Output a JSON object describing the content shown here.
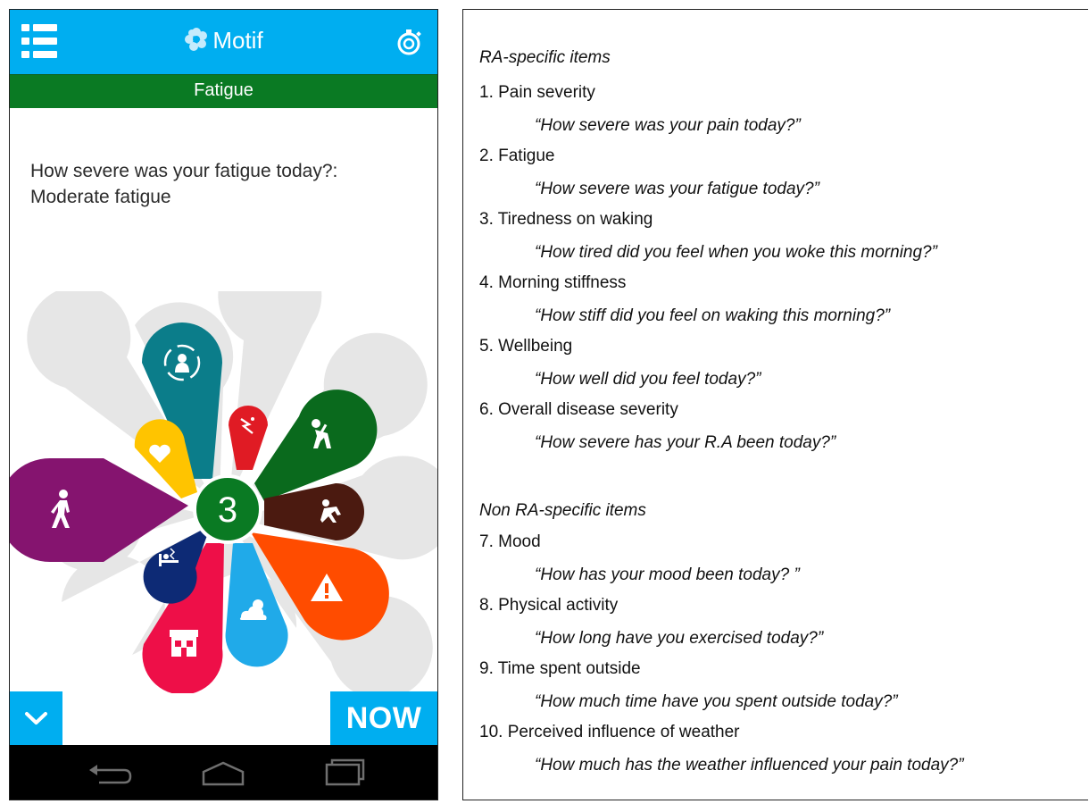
{
  "app": {
    "title": "Motif",
    "section": "Fatigue",
    "question": "How severe was your fatigue today?:",
    "answer": "Moderate fatigue",
    "center_value": "3",
    "now_label": "NOW",
    "icons": {
      "menu": "menu-icon",
      "logo": "flower-logo-icon",
      "timer": "timer-icon",
      "down": "chevron-down-icon",
      "back": "back-icon",
      "home": "home-icon",
      "recents": "recents-icon"
    },
    "petals": [
      {
        "name": "wellbeing-petal",
        "icon": "person-circle-icon",
        "color": "#0b7d8a"
      },
      {
        "name": "pain-petal",
        "icon": "lightning-pain-icon",
        "color": "#e01b24"
      },
      {
        "name": "fatigue-petal",
        "icon": "tired-person-icon",
        "color": "#0a6a1d"
      },
      {
        "name": "stiffness-petal",
        "icon": "stretching-icon",
        "color": "#4b1a10"
      },
      {
        "name": "severity-petal",
        "icon": "warning-icon",
        "color": "#ff4c00"
      },
      {
        "name": "weather-petal",
        "icon": "sun-cloud-icon",
        "color": "#20aae9"
      },
      {
        "name": "outside-petal",
        "icon": "house-icon",
        "color": "#ee0f48"
      },
      {
        "name": "tiredness-waking-petal",
        "icon": "bed-icon",
        "color": "#0d2a75"
      },
      {
        "name": "activity-petal",
        "icon": "walking-icon",
        "color": "#85146f"
      },
      {
        "name": "mood-petal",
        "icon": "heart-icon",
        "color": "#ffc400"
      }
    ],
    "colors": {
      "appbar": "#00aef0",
      "section_bar": "#0a7a23",
      "center": "#0a7a23",
      "petal_background": "#e6e6e6"
    }
  },
  "questionnaire": {
    "ra_heading": "RA-specific items",
    "non_ra_heading": "Non RA-specific items",
    "items": [
      {
        "label": "1. Pain severity",
        "question": "“How severe was your pain today?”"
      },
      {
        "label": "2. Fatigue",
        "question": "“How severe was your fatigue today?”"
      },
      {
        "label": "3. Tiredness on waking",
        "question": "“How tired did you feel when you woke this morning?”"
      },
      {
        "label": "4. Morning stiffness",
        "question": "“How stiff did you feel on waking this morning?”"
      },
      {
        "label": "5. Wellbeing",
        "question": "“How well did you feel today?”"
      },
      {
        "label": "6. Overall disease severity",
        "question": "“How severe has your R.A been today?”"
      },
      {
        "label": "7. Mood",
        "question": "“How has your mood been today? ”"
      },
      {
        "label": "8. Physical activity",
        "question": "“How long have you exercised today?”"
      },
      {
        "label": "9. Time spent outside",
        "question": "“How much time have you spent outside today?”"
      },
      {
        "label": "10. Perceived influence of weather",
        "question": "“How much has the weather influenced your pain today?”"
      }
    ]
  }
}
